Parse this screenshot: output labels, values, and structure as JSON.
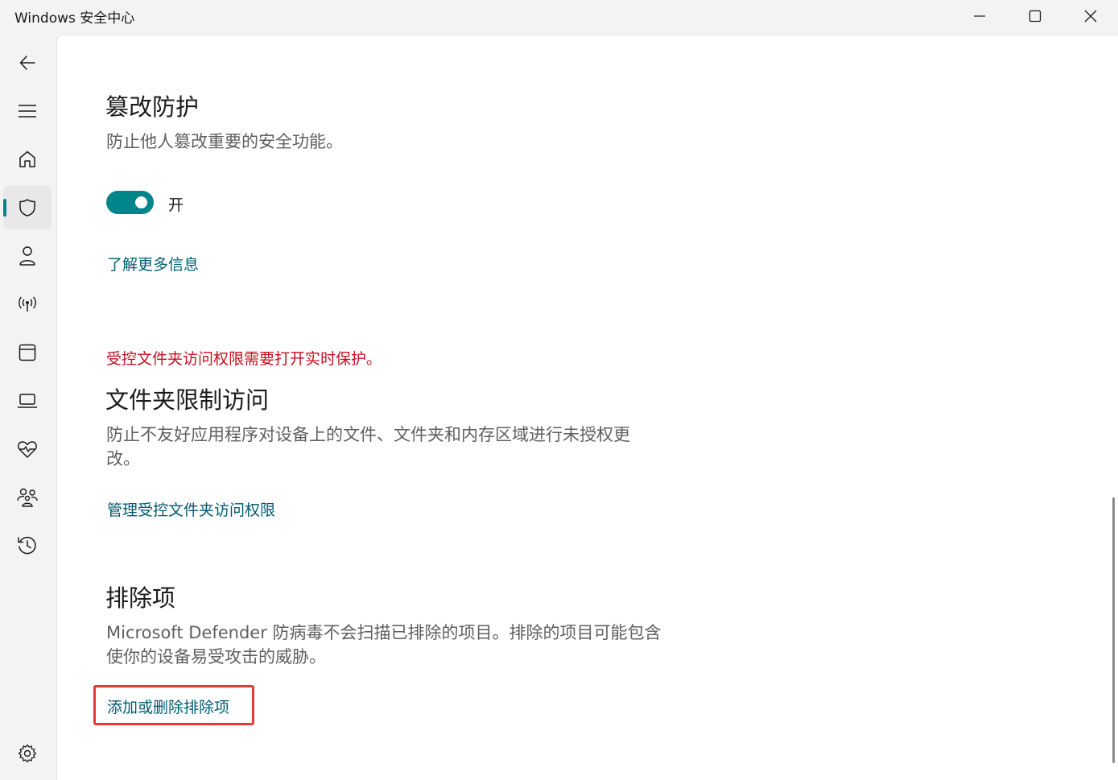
{
  "window": {
    "title": "Windows 安全中心"
  },
  "tamper": {
    "title": "篡改防护",
    "description": "防止他人篡改重要的安全功能。",
    "toggle_state": "开",
    "toggle_on": true,
    "link": "了解更多信息"
  },
  "folder_access": {
    "warning": "受控文件夹访问权限需要打开实时保护。",
    "title": "文件夹限制访问",
    "description_line1": "防止不友好应用程序对设备上的文件、文件夹和内存区域进行未授权更",
    "description_line2": "改。",
    "link": "管理受控文件夹访问权限"
  },
  "exclusions": {
    "title": "排除项",
    "description_line1": "Microsoft Defender 防病毒不会扫描已排除的项目。排除的项目可能包含",
    "description_line2": "使你的设备易受攻击的威胁。",
    "link": "添加或删除排除项"
  },
  "nav": {
    "items": [
      "back-arrow-icon",
      "menu-icon",
      "home-icon",
      "shield-icon",
      "person-icon",
      "wireless-icon",
      "app-browser-icon",
      "laptop-icon",
      "heart-pulse-icon",
      "family-icon",
      "history-icon",
      "settings-gear-icon"
    ],
    "active": "shield-icon"
  },
  "colors": {
    "accent": "#00858a",
    "link": "#005b70",
    "warning": "#c50f1f",
    "highlight_box": "#e53935"
  }
}
